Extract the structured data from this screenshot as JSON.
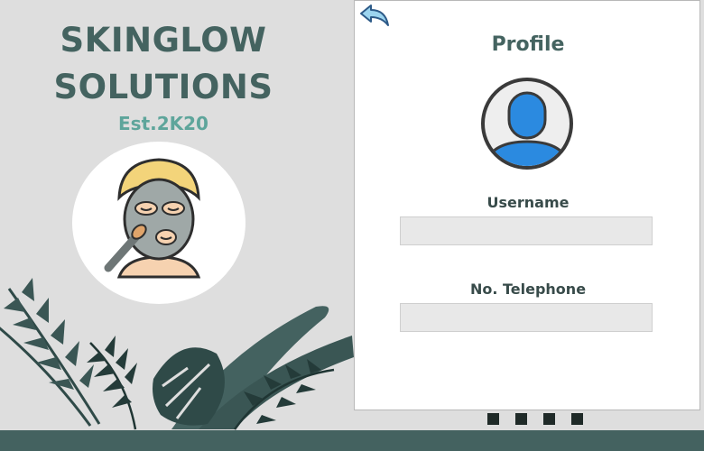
{
  "brand": {
    "line1": "SKINGLOW",
    "line2": "SOLUTIONS",
    "established": "Est.2K20"
  },
  "profile": {
    "title": "Profile",
    "username_label": "Username",
    "username_value": "",
    "telephone_label": "No. Telephone",
    "telephone_value": ""
  },
  "icons": {
    "back": "back-arrow-icon",
    "avatar": "user-avatar-icon",
    "logo": "face-mask-icon"
  },
  "pagination": {
    "count": 4
  },
  "colors": {
    "brand": "#446360",
    "accent": "#5ea59b",
    "background": "#dedede",
    "bar": "#446260",
    "avatar_blue": "#2b8ae0"
  }
}
